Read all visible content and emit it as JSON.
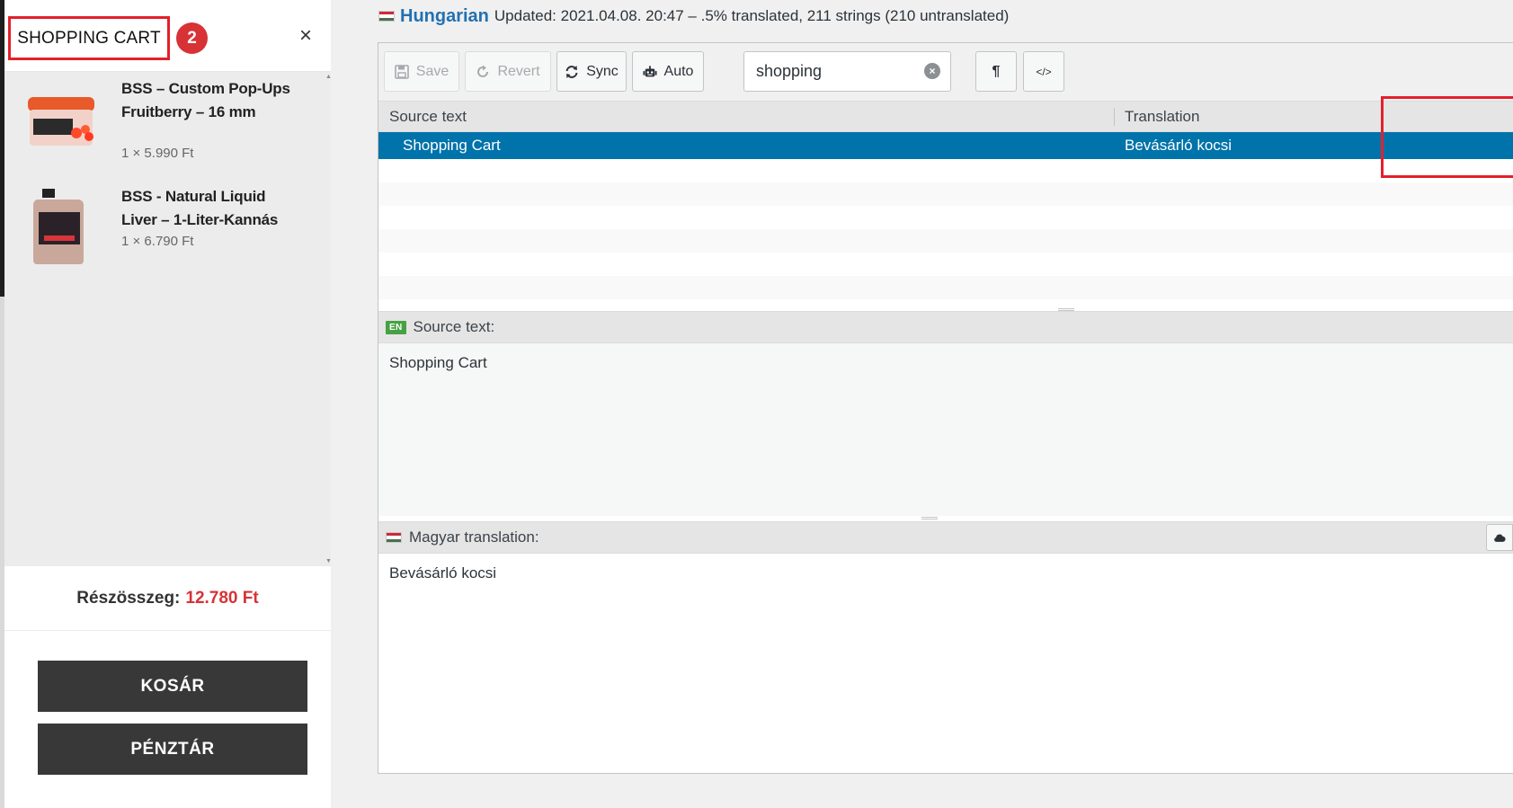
{
  "cart": {
    "title": "SHOPPING CART",
    "badge": "2",
    "close_glyph": "×",
    "items": [
      {
        "name": "BSS – Custom Pop-Ups Fruitberry – 16 mm",
        "qty_price": "1 × 5.990 Ft",
        "thumb_icon": "popups-jar-icon"
      },
      {
        "name": "BSS - Natural Liquid Liver – 1-Liter-Kannás",
        "qty_price": "1 × 6.790 Ft",
        "thumb_icon": "liquid-bottle-icon"
      }
    ],
    "subtotal_label": "Részösszeg:",
    "subtotal_value": "12.780 Ft",
    "cart_button": "KOSÁR",
    "checkout_button": "PÉNZTÁR"
  },
  "editor": {
    "language": "Hungarian",
    "meta": "Updated: 2021.04.08. 20:47 – .5% translated, 211 strings (210 untranslated)",
    "toolbar": {
      "save": "Save",
      "revert": "Revert",
      "sync": "Sync",
      "auto": "Auto",
      "search_value": "shopping",
      "pilcrow": "¶",
      "code": "</>"
    },
    "columns": {
      "source": "Source text",
      "translation": "Translation"
    },
    "selected_row": {
      "source": "Shopping Cart",
      "translation": "Bevásárló kocsi"
    },
    "source_pane": {
      "badge": "EN",
      "label": "Source text:",
      "text": "Shopping Cart"
    },
    "translation_pane": {
      "label": "Magyar translation:",
      "text": "Bevásárló kocsi"
    }
  },
  "colors": {
    "accent_blue": "#0073aa",
    "highlight_red": "#e3202b",
    "price_red": "#d73236",
    "button_dark": "#383838"
  }
}
